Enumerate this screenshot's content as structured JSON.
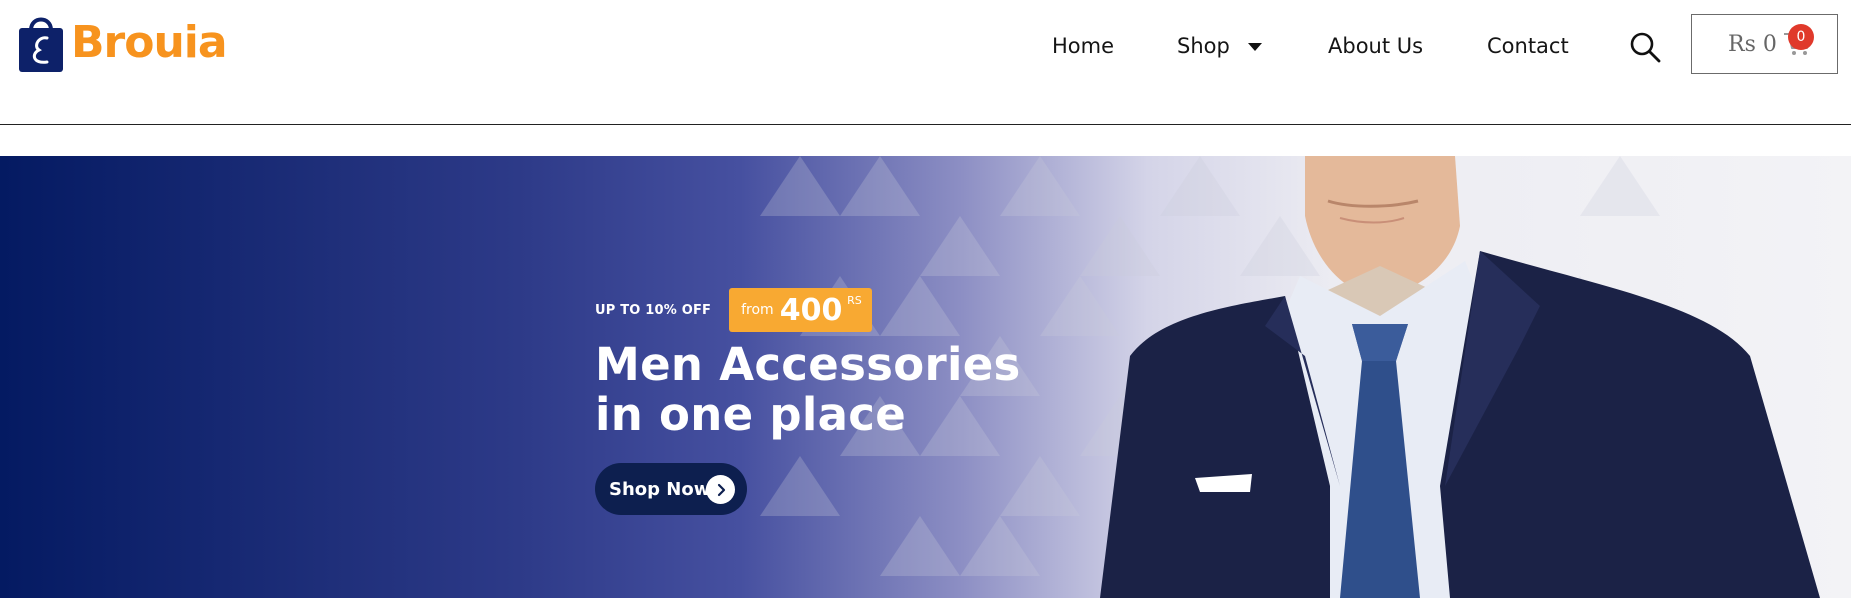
{
  "brand": {
    "name": "Brouia",
    "color": "#f7931e",
    "bag_color": "#0d2169"
  },
  "nav": {
    "items": [
      {
        "label": "Home"
      },
      {
        "label": "Shop"
      },
      {
        "label": "About Us"
      },
      {
        "label": "Contact"
      }
    ]
  },
  "header": {
    "search_icon": "search-icon",
    "cart": {
      "amount": "Rs 0",
      "count": "0",
      "icon": "cart-icon",
      "badge_color": "#e0392b"
    }
  },
  "hero": {
    "promo": "UP TO 10% OFF",
    "price_from": "from",
    "price_value": "400",
    "price_currency": "RS",
    "title_line1": "Men Accessories",
    "title_line2": "in one place",
    "cta_label": "Shop Now",
    "badge_color": "#f8a932",
    "cta_color": "#0d1f4f"
  }
}
